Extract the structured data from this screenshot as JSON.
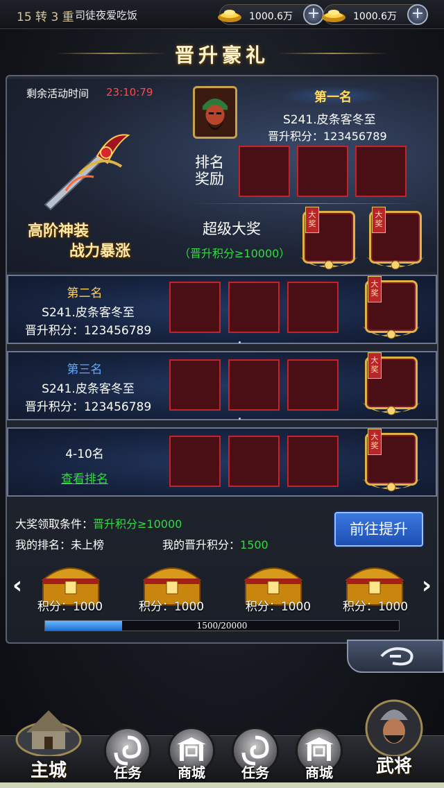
{
  "topbar": {
    "rank": "15 转 3 重",
    "player_name": "司徒夜爱吃饭",
    "currency1": "1000.6万",
    "currency2": "1000.6万",
    "plus": "+"
  },
  "title": "晋升豪礼",
  "countdown": {
    "label": "剩余活动时间",
    "time": "23:10:79"
  },
  "slogan": {
    "line1": "高阶神装",
    "line2": "战力暴涨"
  },
  "first": {
    "rank_label": "第一名",
    "server": "S241.皮条客冬至",
    "score": "晋升积分：123456789",
    "reward_label": "排名\n奖励"
  },
  "grand_prize": {
    "title": "超级大奖",
    "condition": "（晋升积分≥10000）",
    "tag": "大奖"
  },
  "rows": [
    {
      "name": "第二名",
      "name_color": "#ffd25a",
      "server": "S241.皮条客冬至",
      "score": "晋升积分：123456789"
    },
    {
      "name": "第三名",
      "name_color": "#5fa8ff",
      "server": "S241.皮条客冬至",
      "score": "晋升积分：123456789"
    },
    {
      "name": "4-10名",
      "name_color": "#ffffff",
      "link": "查看排名"
    }
  ],
  "info": {
    "cond_label": "大奖领取条件：",
    "cond_value": "晋升积分≥10000",
    "my_rank": "我的排名：未上榜",
    "my_score_label": "我的晋升积分：",
    "my_score_value": "1500"
  },
  "go_button": "前往提升",
  "chests": [
    {
      "label": "积分：1000"
    },
    {
      "label": "积分：1000"
    },
    {
      "label": "积分：1000"
    },
    {
      "label": "积分：1000"
    }
  ],
  "progress": {
    "current": 1500,
    "max": 20000,
    "text": "1500/20000"
  },
  "nav": {
    "main_city": "主城",
    "items": [
      "任务",
      "商城",
      "任务",
      "商城"
    ],
    "general": "武将"
  },
  "colors": {
    "accent_green": "#35d845",
    "countdown_red": "#ff4b4b",
    "slot_red": "#c4232c"
  }
}
